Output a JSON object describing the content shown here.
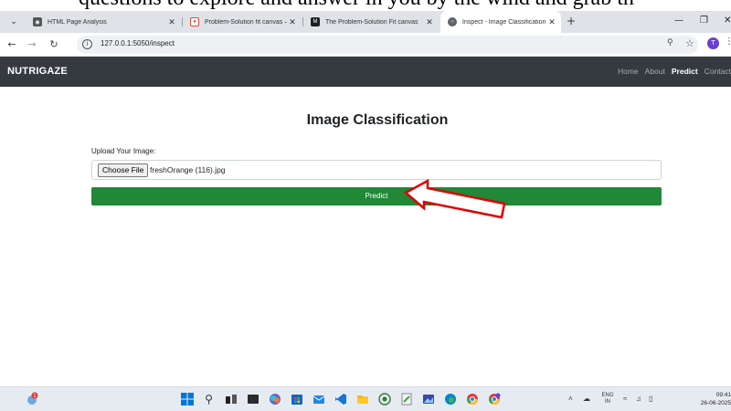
{
  "top_snippet": "questions to explore and answer in you by the wind and grab th",
  "tabs": [
    {
      "label": "HTML Page Analysis",
      "active": false
    },
    {
      "label": "Problem-Solution fit canvas —",
      "active": false
    },
    {
      "label": "The Problem-Solution Fit canvas",
      "active": false
    },
    {
      "label": "Inspect - Image Classification",
      "active": true
    }
  ],
  "address": {
    "url": "127.0.0.1:5050/inspect",
    "profile_initial": "T"
  },
  "navbar": {
    "brand": "NUTRIGAZE",
    "links": [
      "Home",
      "About",
      "Predict",
      "Contact"
    ]
  },
  "page": {
    "title": "Image Classification",
    "upload_label": "Upload Your Image:",
    "file_button": "Choose File",
    "file_name": "freshOrange (116).jpg",
    "predict_label": "Predict"
  },
  "taskbar": {
    "lang_top": "ENG",
    "lang_bottom": "IN",
    "time": "09:41",
    "date": "26-06-2025"
  },
  "colors": {
    "navbar_bg": "#343a40",
    "predict_bg": "#218838",
    "arrow_stroke": "#e00000"
  }
}
